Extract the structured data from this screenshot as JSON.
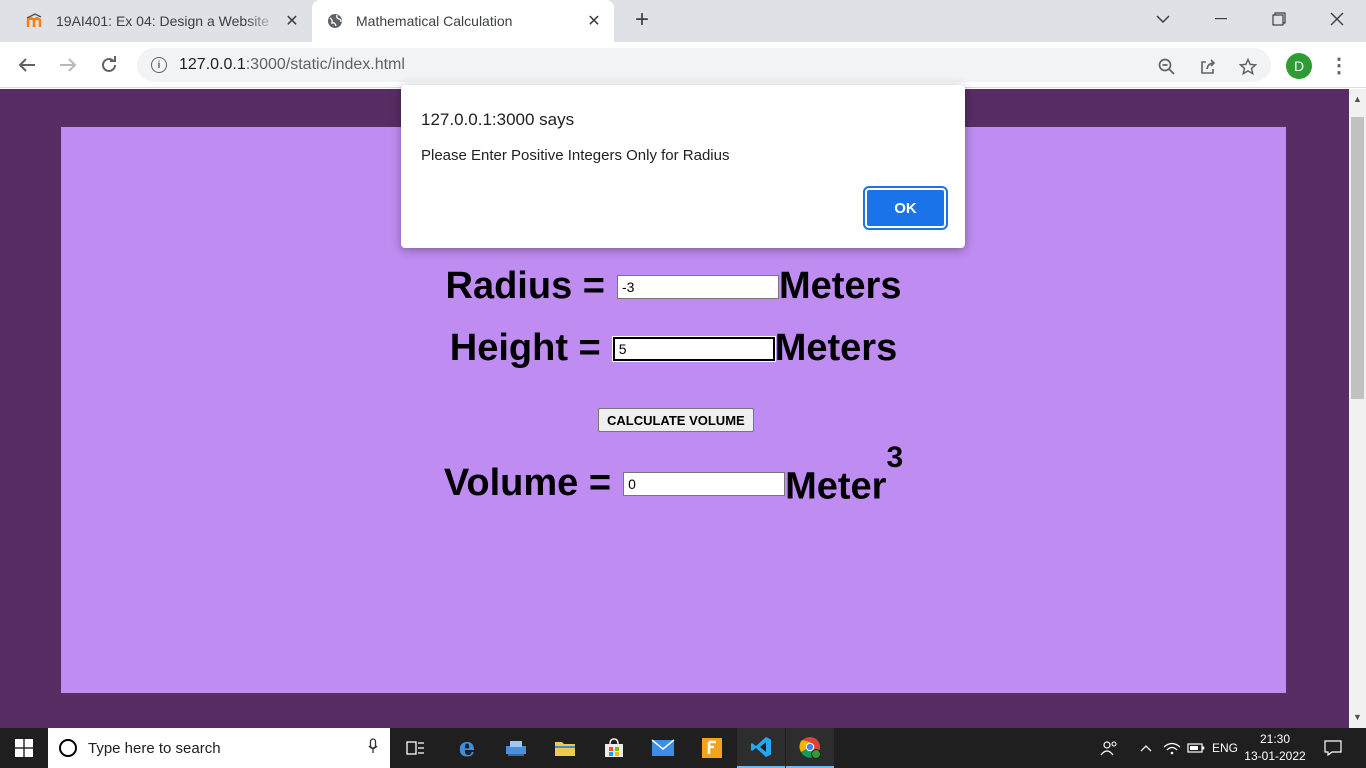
{
  "browser": {
    "tabs": [
      {
        "title": "19AI401: Ex 04: Design a Website",
        "active": false
      },
      {
        "title": "Mathematical Calculation",
        "active": true
      }
    ],
    "url_host": "127.0.0.1",
    "url_rest": ":3000/static/index.html",
    "avatar_initial": "D"
  },
  "page": {
    "radius_label": "Radius =",
    "radius_value": "-3",
    "radius_unit": "Meters",
    "height_label": "Height =",
    "height_value": "5",
    "height_unit": "Meters",
    "button_label": "CALCULATE VOLUME",
    "volume_label": "Volume =",
    "volume_value": "0",
    "volume_unit": "Meter",
    "volume_exponent": "3",
    "background_color": "#582d64",
    "panel_color": "#bf8cf2"
  },
  "dialog": {
    "title": "127.0.0.1:3000 says",
    "message": "Please Enter Positive Integers Only for Radius",
    "ok_label": "OK"
  },
  "taskbar": {
    "search_placeholder": "Type here to search",
    "language": "ENG",
    "time": "21:30",
    "date": "13-01-2022"
  }
}
